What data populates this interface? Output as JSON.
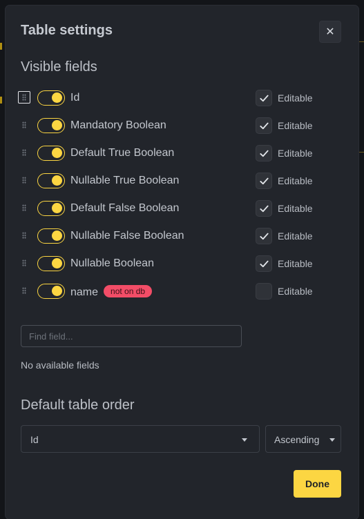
{
  "modal": {
    "title": "Table settings",
    "close_icon": "close-icon"
  },
  "visible_fields": {
    "heading": "Visible fields",
    "editable_label": "Editable",
    "fields": [
      {
        "label": "Id",
        "enabled": true,
        "editable": true,
        "badge": ""
      },
      {
        "label": "Mandatory Boolean",
        "enabled": true,
        "editable": true,
        "badge": ""
      },
      {
        "label": "Default True Boolean",
        "enabled": true,
        "editable": true,
        "badge": ""
      },
      {
        "label": "Nullable True Boolean",
        "enabled": true,
        "editable": true,
        "badge": ""
      },
      {
        "label": "Default False Boolean",
        "enabled": true,
        "editable": true,
        "badge": ""
      },
      {
        "label": "Nullable False Boolean",
        "enabled": true,
        "editable": true,
        "badge": ""
      },
      {
        "label": "Nullable Boolean",
        "enabled": true,
        "editable": true,
        "badge": ""
      },
      {
        "label": "name",
        "enabled": true,
        "editable": false,
        "badge": "not on db"
      }
    ]
  },
  "available_fields": {
    "search_placeholder": "Find field...",
    "search_value": "",
    "empty_text": "No available fields"
  },
  "table_order": {
    "heading": "Default table order",
    "field_value": "Id",
    "direction": "Ascending"
  },
  "actions": {
    "done_label": "Done"
  },
  "colors": {
    "accent": "#fcd642",
    "badge": "#f24d67",
    "modal_bg": "#22252b",
    "page_bg": "#131519"
  }
}
